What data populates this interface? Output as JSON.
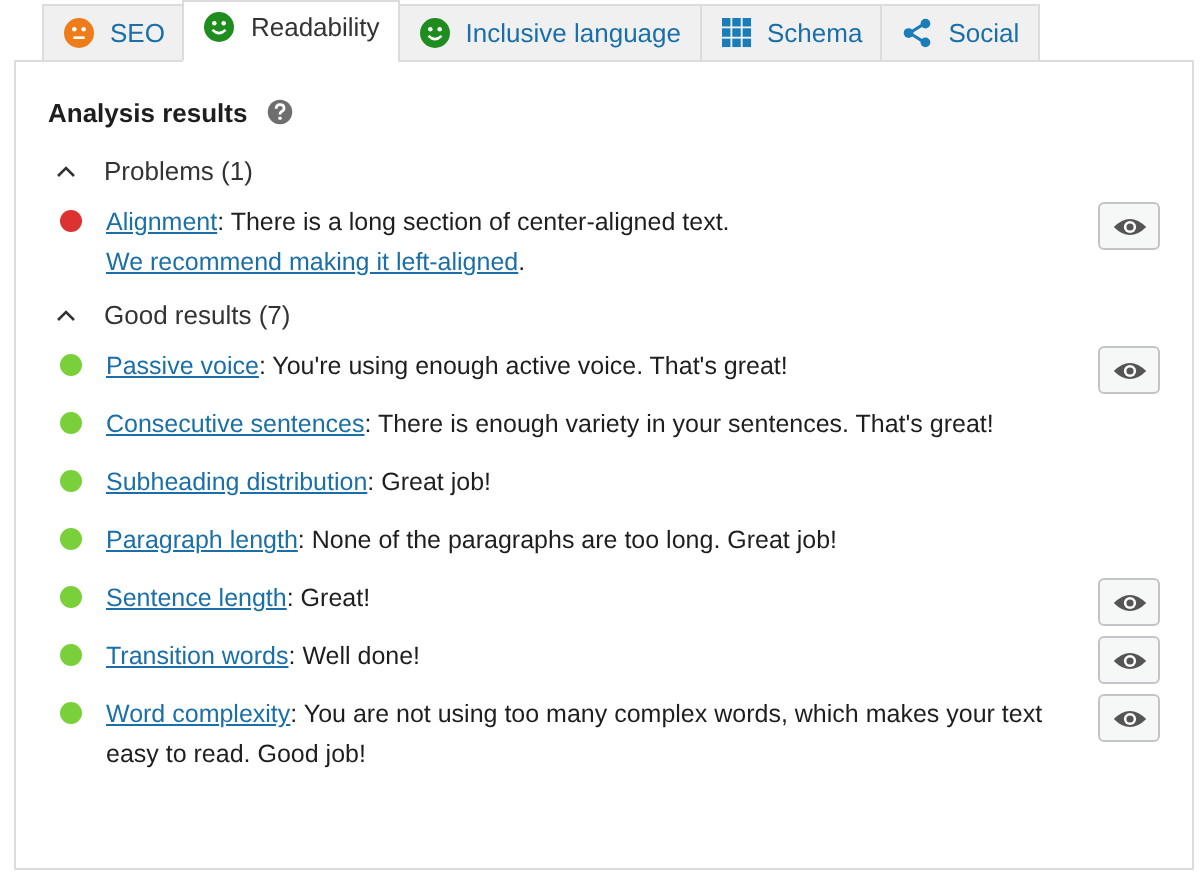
{
  "tabs": [
    {
      "label": "SEO",
      "kind": "neutral",
      "color": "#ee7c1b",
      "selected": false
    },
    {
      "label": "Readability",
      "kind": "smile",
      "color": "#1e8c1e",
      "selected": true
    },
    {
      "label": "Inclusive language",
      "kind": "smile",
      "color": "#1e8c1e",
      "selected": false
    },
    {
      "label": "Schema",
      "kind": "grid",
      "selected": false
    },
    {
      "label": "Social",
      "kind": "share",
      "selected": false
    }
  ],
  "panel": {
    "title": "Analysis results",
    "sections": [
      {
        "heading": "Problems (1)",
        "expanded": true,
        "results": [
          {
            "color": "#dc3232",
            "highlight_button": true,
            "parts": [
              {
                "kind": "link",
                "text": "Alignment"
              },
              {
                "kind": "text",
                "text": ": There is a long section of center-aligned text. "
              },
              {
                "kind": "link",
                "text": "We recommend making it left-aligned"
              },
              {
                "kind": "text",
                "text": "."
              }
            ]
          }
        ]
      },
      {
        "heading": "Good results (7)",
        "expanded": true,
        "results": [
          {
            "color": "#7ad03a",
            "highlight_button": true,
            "parts": [
              {
                "kind": "link",
                "text": "Passive voice"
              },
              {
                "kind": "text",
                "text": ": You're using enough active voice. That's great!"
              }
            ]
          },
          {
            "color": "#7ad03a",
            "highlight_button": false,
            "parts": [
              {
                "kind": "link",
                "text": "Consecutive sentences"
              },
              {
                "kind": "text",
                "text": ": There is enough variety in your sentences. That's great!"
              }
            ]
          },
          {
            "color": "#7ad03a",
            "highlight_button": false,
            "parts": [
              {
                "kind": "link",
                "text": "Subheading distribution"
              },
              {
                "kind": "text",
                "text": ": Great job!"
              }
            ]
          },
          {
            "color": "#7ad03a",
            "highlight_button": false,
            "parts": [
              {
                "kind": "link",
                "text": "Paragraph length"
              },
              {
                "kind": "text",
                "text": ": None of the paragraphs are too long. Great job!"
              }
            ]
          },
          {
            "color": "#7ad03a",
            "highlight_button": true,
            "parts": [
              {
                "kind": "link",
                "text": "Sentence length"
              },
              {
                "kind": "text",
                "text": ": Great!"
              }
            ]
          },
          {
            "color": "#7ad03a",
            "highlight_button": true,
            "parts": [
              {
                "kind": "link",
                "text": "Transition words"
              },
              {
                "kind": "text",
                "text": ": Well done!"
              }
            ]
          },
          {
            "color": "#7ad03a",
            "highlight_button": true,
            "parts": [
              {
                "kind": "link",
                "text": "Word complexity"
              },
              {
                "kind": "text",
                "text": ": You are not using too many complex words, which makes your text easy to read. Good job!"
              }
            ]
          }
        ]
      }
    ]
  }
}
